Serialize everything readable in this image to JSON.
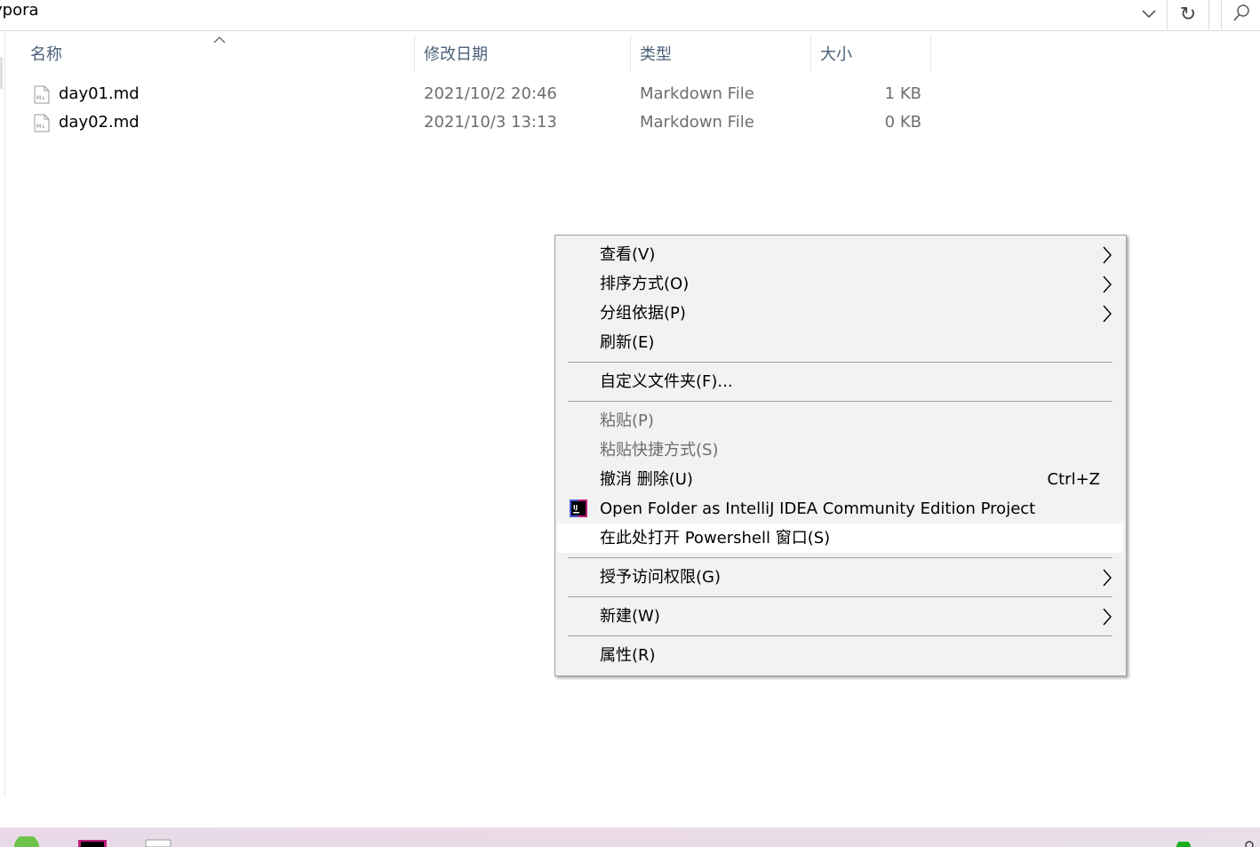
{
  "address_bar": {
    "path_text": "ypora",
    "dropdown_icon": "chevron-down-icon",
    "refresh_icon": "refresh-icon",
    "search_icon": "search-icon"
  },
  "columns": {
    "name": "名称",
    "date_modified": "修改日期",
    "type": "类型",
    "size": "大小"
  },
  "files": [
    {
      "name": "day01.md",
      "date": "2021/10/2 20:46",
      "type": "Markdown File",
      "size": "1 KB"
    },
    {
      "name": "day02.md",
      "date": "2021/10/3 13:13",
      "type": "Markdown File",
      "size": "0 KB"
    }
  ],
  "context_menu": {
    "view": "查看(V)",
    "sort_by": "排序方式(O)",
    "group_by": "分组依据(P)",
    "refresh": "刷新(E)",
    "customize_folder": "自定义文件夹(F)...",
    "paste": "粘贴(P)",
    "paste_shortcut": "粘贴快捷方式(S)",
    "undo_delete": "撤消 删除(U)",
    "undo_shortcut": "Ctrl+Z",
    "open_intellij": "Open Folder as IntelliJ IDEA Community Edition Project",
    "open_powershell": "在此处打开 Powershell 窗口(S)",
    "grant_access": "授予访问权限(G)",
    "new": "新建(W)",
    "properties": "属性(R)"
  },
  "colors": {
    "menu_bg": "#f2f2f2",
    "menu_hover": "#ffffff",
    "header_text": "#4c607a",
    "disabled_text": "#6d6d6d"
  }
}
